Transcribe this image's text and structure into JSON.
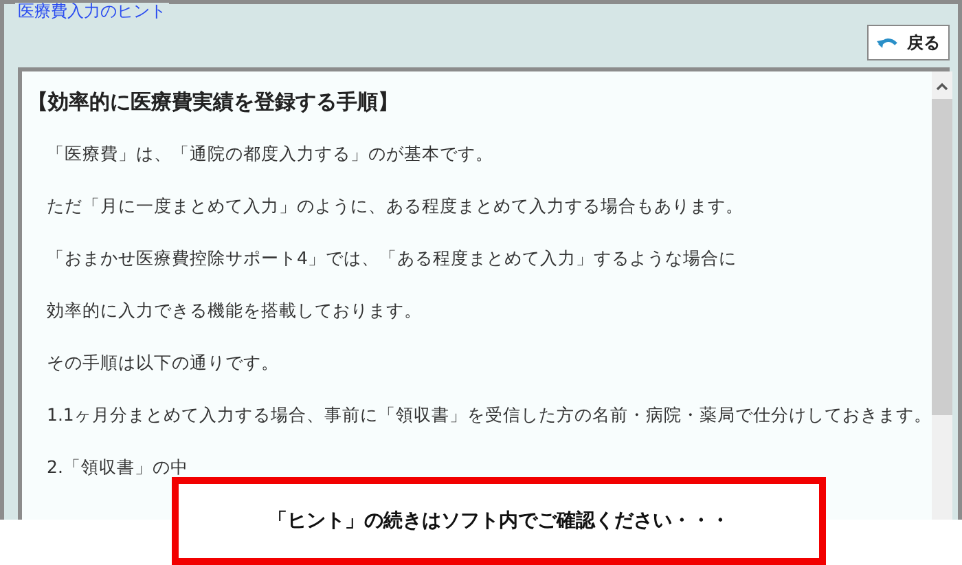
{
  "group": {
    "title": "医療費入力のヒント"
  },
  "back_button": {
    "label": "戻る"
  },
  "hint": {
    "heading": "【効率的に医療費実績を登録する手順】",
    "paragraphs": [
      "「医療費」は、「通院の都度入力する」のが基本です。",
      "ただ「月に一度まとめて入力」のように、ある程度まとめて入力する場合もあります。",
      "「おまかせ医療費控除サポート4」では、「ある程度まとめて入力」するような場合に",
      "効率的に入力できる機能を搭載しております。",
      "その手順は以下の通りです。",
      "1.1ヶ月分まとめて入力する場合、事前に「領収書」を受信した方の名前・病院・薬局で仕分けしておきます。",
      "2.「領収書」の中"
    ]
  },
  "notice": {
    "text": "「ヒント」の続きはソフト内でご確認ください・・・"
  }
}
